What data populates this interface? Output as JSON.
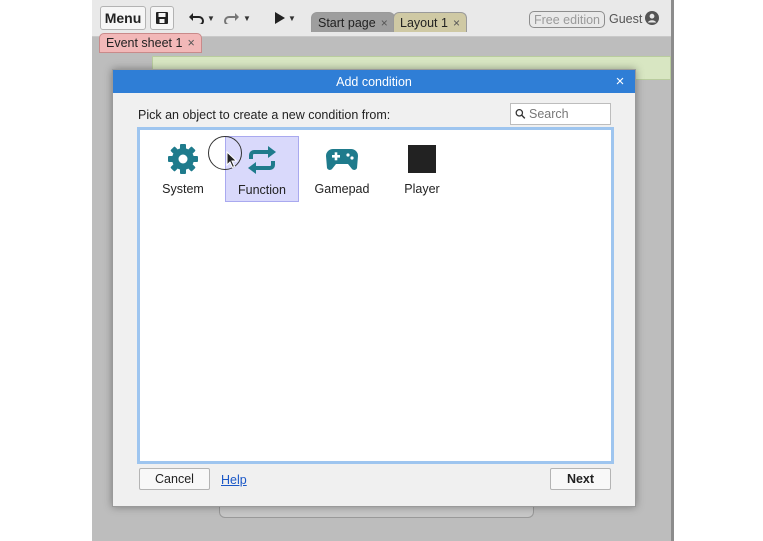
{
  "toolbar": {
    "menu_label": "Menu",
    "tabs": [
      {
        "label": "Start page",
        "close": "×"
      },
      {
        "label": "Layout 1",
        "close": "×"
      }
    ],
    "free_edition": "Free edition",
    "user": "Guest"
  },
  "event_sheet_tab": {
    "label": "Event sheet 1",
    "close": "×"
  },
  "dialog": {
    "title": "Add condition",
    "close": "×",
    "prompt": "Pick an object to create a new condition from:",
    "search_placeholder": "Search",
    "objects": [
      {
        "label": "System",
        "icon": "gear-icon",
        "color": "#1f7b8c"
      },
      {
        "label": "Function",
        "icon": "function-arrows-icon",
        "color": "#1f7b8c",
        "selected": true
      },
      {
        "label": "Gamepad",
        "icon": "gamepad-icon",
        "color": "#1f7b8c"
      },
      {
        "label": "Player",
        "icon": "sprite-black-square-icon",
        "color": "#222222"
      }
    ],
    "cancel_label": "Cancel",
    "help_label": "Help",
    "next_label": "Next"
  },
  "colors": {
    "titlebar": "#2f7ed6",
    "selection": "#d9d9fb",
    "list_border": "#9ec5ef",
    "icon_teal": "#1f7b8c"
  }
}
